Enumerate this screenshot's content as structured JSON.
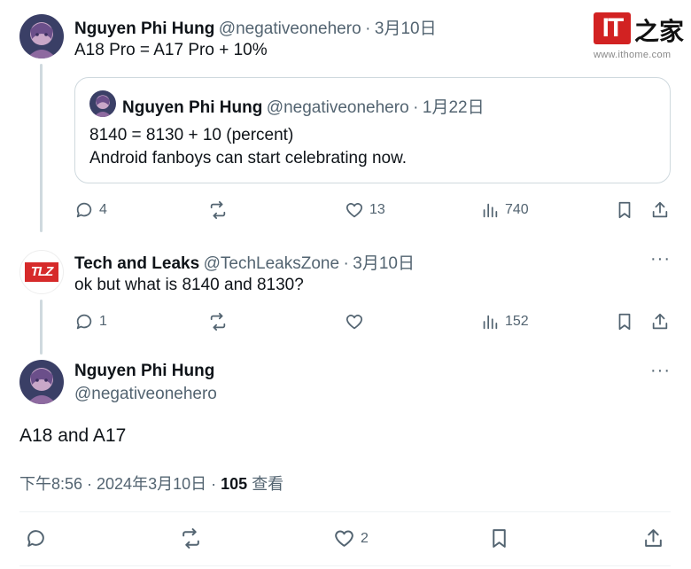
{
  "tweet1": {
    "name": "Nguyen Phi Hung",
    "handle": "@negativeonehero",
    "sep": "·",
    "date": "3月10日",
    "text": "A18 Pro = A17 Pro + 10%",
    "quote": {
      "name": "Nguyen Phi Hung",
      "handle": "@negativeonehero",
      "sep": "·",
      "date": "1月22日",
      "line1": "8140 = 8130 + 10 (percent)",
      "line2": "Android fanboys can start celebrating now."
    },
    "actions": {
      "replies": "4",
      "reposts": "",
      "likes": "13",
      "views": "740"
    }
  },
  "tweet2": {
    "name": "Tech and Leaks",
    "handle": "@TechLeaksZone",
    "sep": "·",
    "date": "3月10日",
    "text": "ok but what is 8140 and 8130?",
    "avatar_text": "TLZ",
    "actions": {
      "replies": "1",
      "reposts": "",
      "likes": "",
      "views": "152"
    },
    "more": "···"
  },
  "tweet3": {
    "name": "Nguyen Phi Hung",
    "handle": "@negativeonehero",
    "text": "A18 and A17",
    "time": "下午8:56 · 2024年3月10日 ·",
    "views_count": "105",
    "views_label": "查看",
    "more": "···",
    "actions": {
      "likes": "2"
    }
  },
  "watermark": {
    "logo": "IT",
    "brand": "之家",
    "url": "www.ithome.com"
  },
  "colors": {
    "text": "#0f1419",
    "muted": "#536471",
    "border": "#cfd9de",
    "logo_red": "#d22222"
  }
}
